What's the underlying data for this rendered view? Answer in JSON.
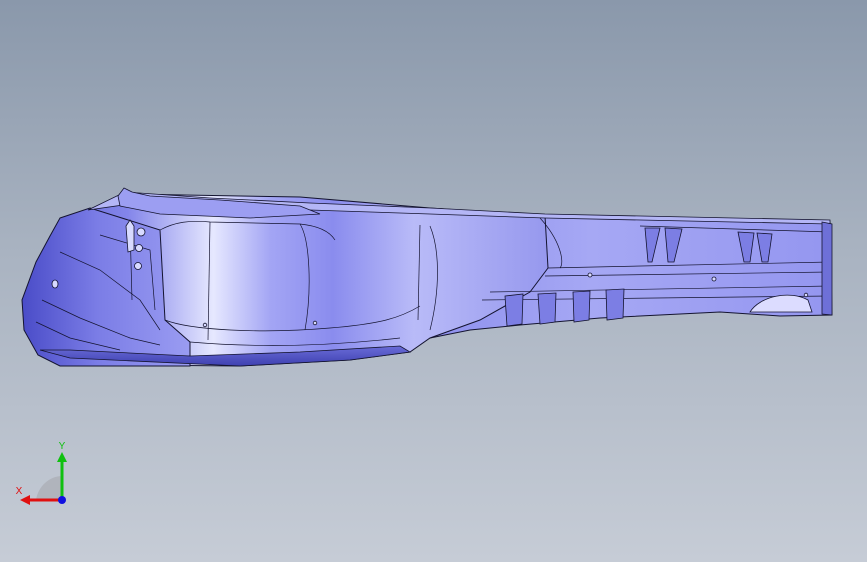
{
  "triad": {
    "x_label": "X",
    "y_label": "Y",
    "x_color": "#e01010",
    "y_color": "#10c010",
    "z_color": "#1010e0"
  },
  "colors": {
    "part_fill": "#8a8cf0",
    "part_highlight": "#e6e8ff",
    "part_shadow": "#4a4cc8",
    "edge": "#141430",
    "background_top": "#8a98ab",
    "background_bottom": "#c6ccd6"
  }
}
